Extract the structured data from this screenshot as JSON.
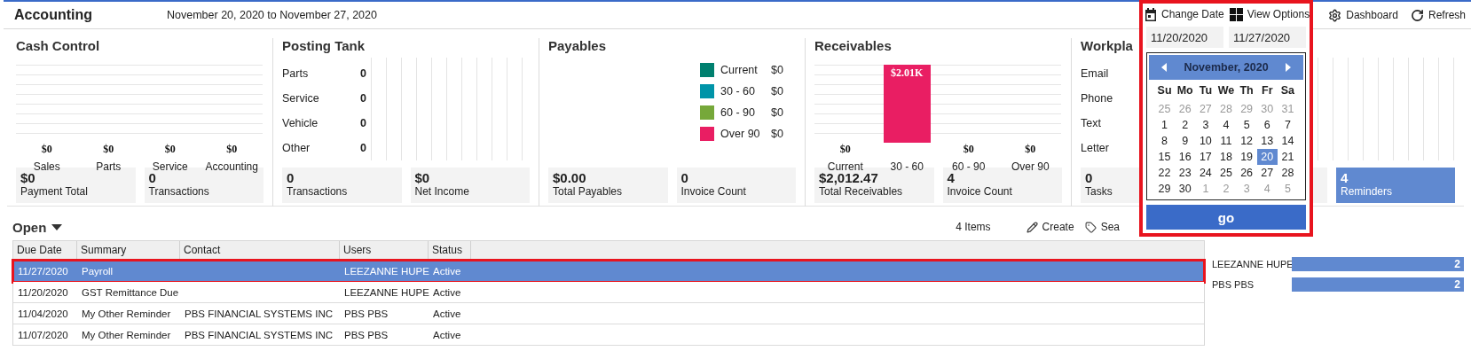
{
  "header": {
    "title": "Accounting",
    "date_range": "November 20, 2020 to November 27, 2020",
    "actions": [
      {
        "label": "Change Date",
        "kind": "calendar"
      },
      {
        "label": "View Options",
        "kind": "grid"
      },
      {
        "label": "Dashboard",
        "kind": "gear"
      },
      {
        "label": "Refresh",
        "kind": "refresh"
      }
    ]
  },
  "panels": [
    {
      "kind": "columns",
      "title": "Cash Control",
      "bars": [
        {
          "label": "Sales",
          "value": "$0"
        },
        {
          "label": "Parts",
          "value": "$0"
        },
        {
          "label": "Service",
          "value": "$0"
        },
        {
          "label": "Accounting",
          "value": "$0"
        }
      ],
      "stats": [
        {
          "value": "$0",
          "label": "Payment Total"
        },
        {
          "value": "0",
          "label": "Transactions"
        }
      ]
    },
    {
      "kind": "rows",
      "title": "Posting Tank",
      "rows": [
        {
          "label": "Parts",
          "value": "0"
        },
        {
          "label": "Service",
          "value": "0"
        },
        {
          "label": "Vehicle",
          "value": "0"
        },
        {
          "label": "Other",
          "value": "0"
        }
      ],
      "stats": [
        {
          "value": "0",
          "label": "Transactions"
        },
        {
          "value": "$0",
          "label": "Net Income"
        }
      ]
    },
    {
      "kind": "legend",
      "title": "Payables",
      "legend": [
        {
          "label": "Current",
          "value": "$0",
          "color": "#00806f"
        },
        {
          "label": "30 - 60",
          "value": "$0",
          "color": "#0094a8"
        },
        {
          "label": "60 - 90",
          "value": "$0",
          "color": "#76a83a"
        },
        {
          "label": "Over 90",
          "value": "$0",
          "color": "#e91e63"
        }
      ],
      "stats": [
        {
          "value": "$0.00",
          "label": "Total Payables"
        },
        {
          "value": "0",
          "label": "Invoice Count"
        }
      ]
    },
    {
      "kind": "columns",
      "title": "Receivables",
      "bars": [
        {
          "label": "Current",
          "value": "$0"
        },
        {
          "label": "30 - 60",
          "value": "$2.01K",
          "level": 1
        },
        {
          "label": "60 - 90",
          "value": "$0"
        },
        {
          "label": "Over 90",
          "value": "$0"
        }
      ],
      "stats": [
        {
          "value": "$2,012.47",
          "label": "Total Receivables"
        },
        {
          "value": "4",
          "label": "Invoice Count"
        }
      ]
    },
    {
      "kind": "workplan",
      "title": "Workpla",
      "rows": [
        {
          "label": "Email"
        },
        {
          "label": "Phone"
        },
        {
          "label": "Text"
        },
        {
          "label": "Letter"
        }
      ],
      "stats": [
        {
          "value": "0",
          "label": "Tasks",
          "selected": false
        },
        {
          "selected": false
        },
        {
          "value": "4",
          "label": "Reminders",
          "selected": true
        }
      ]
    }
  ],
  "list": {
    "title": "Open",
    "count": "4 Items",
    "actions": [
      {
        "label": "Create",
        "kind": "pencil"
      },
      {
        "label": "Sea",
        "kind": "tag"
      }
    ],
    "columns": [
      "Due Date",
      "Summary",
      "Contact",
      "Users",
      "Status"
    ],
    "rows": [
      {
        "cells": [
          "11/27/2020",
          "Payroll",
          "",
          "LEEZANNE HUPE",
          "Active"
        ],
        "selected": true,
        "highlighted": true
      },
      {
        "cells": [
          "11/20/2020",
          "GST Remittance Due",
          "",
          "LEEZANNE HUPE",
          "Active"
        ],
        "selected": false,
        "highlighted": false
      },
      {
        "cells": [
          "11/04/2020",
          "My Other Reminder",
          "PBS FINANCIAL SYSTEMS INC",
          "PBS PBS",
          "Active"
        ],
        "selected": false,
        "highlighted": false
      },
      {
        "cells": [
          "11/07/2020",
          "My Other Reminder",
          "PBS FINANCIAL SYSTEMS INC",
          "PBS PBS",
          "Active"
        ],
        "selected": false,
        "highlighted": false
      }
    ]
  },
  "user_chart": {
    "chart_data": {
      "type": "bar",
      "orientation": "horizontal",
      "categories": [
        "LEEZANNE HUPE",
        "PBS PBS"
      ],
      "values": [
        2,
        2
      ],
      "data_labels": true
    }
  },
  "date_picker": {
    "highlighted": true,
    "start": "11/20/2020",
    "end": "11/27/2020",
    "month": "November, 2020",
    "weekdays": [
      "Su",
      "Mo",
      "Tu",
      "We",
      "Th",
      "Fr",
      "Sa"
    ],
    "days": [
      {
        "label": "25",
        "muted": true,
        "selected": false
      },
      {
        "label": "26",
        "muted": true,
        "selected": false
      },
      {
        "label": "27",
        "muted": true,
        "selected": false
      },
      {
        "label": "28",
        "muted": true,
        "selected": false
      },
      {
        "label": "29",
        "muted": true,
        "selected": false
      },
      {
        "label": "30",
        "muted": true,
        "selected": false
      },
      {
        "label": "31",
        "muted": true,
        "selected": false
      },
      {
        "label": "1",
        "muted": false,
        "selected": false
      },
      {
        "label": "2",
        "muted": false,
        "selected": false
      },
      {
        "label": "3",
        "muted": false,
        "selected": false
      },
      {
        "label": "4",
        "muted": false,
        "selected": false
      },
      {
        "label": "5",
        "muted": false,
        "selected": false
      },
      {
        "label": "6",
        "muted": false,
        "selected": false
      },
      {
        "label": "7",
        "muted": false,
        "selected": false
      },
      {
        "label": "8",
        "muted": false,
        "selected": false
      },
      {
        "label": "9",
        "muted": false,
        "selected": false
      },
      {
        "label": "10",
        "muted": false,
        "selected": false
      },
      {
        "label": "11",
        "muted": false,
        "selected": false
      },
      {
        "label": "12",
        "muted": false,
        "selected": false
      },
      {
        "label": "13",
        "muted": false,
        "selected": false
      },
      {
        "label": "14",
        "muted": false,
        "selected": false
      },
      {
        "label": "15",
        "muted": false,
        "selected": false
      },
      {
        "label": "16",
        "muted": false,
        "selected": false
      },
      {
        "label": "17",
        "muted": false,
        "selected": false
      },
      {
        "label": "18",
        "muted": false,
        "selected": false
      },
      {
        "label": "19",
        "muted": false,
        "selected": false
      },
      {
        "label": "20",
        "muted": false,
        "selected": true
      },
      {
        "label": "21",
        "muted": false,
        "selected": false
      },
      {
        "label": "22",
        "muted": false,
        "selected": false
      },
      {
        "label": "23",
        "muted": false,
        "selected": false
      },
      {
        "label": "24",
        "muted": false,
        "selected": false
      },
      {
        "label": "25",
        "muted": false,
        "selected": false
      },
      {
        "label": "26",
        "muted": false,
        "selected": false
      },
      {
        "label": "27",
        "muted": false,
        "selected": false
      },
      {
        "label": "28",
        "muted": false,
        "selected": false
      },
      {
        "label": "29",
        "muted": false,
        "selected": false
      },
      {
        "label": "30",
        "muted": false,
        "selected": false
      },
      {
        "label": "1",
        "muted": true,
        "selected": false
      },
      {
        "label": "2",
        "muted": true,
        "selected": false
      },
      {
        "label": "3",
        "muted": true,
        "selected": false
      },
      {
        "label": "4",
        "muted": true,
        "selected": false
      },
      {
        "label": "5",
        "muted": true,
        "selected": false
      }
    ],
    "button": "go"
  }
}
